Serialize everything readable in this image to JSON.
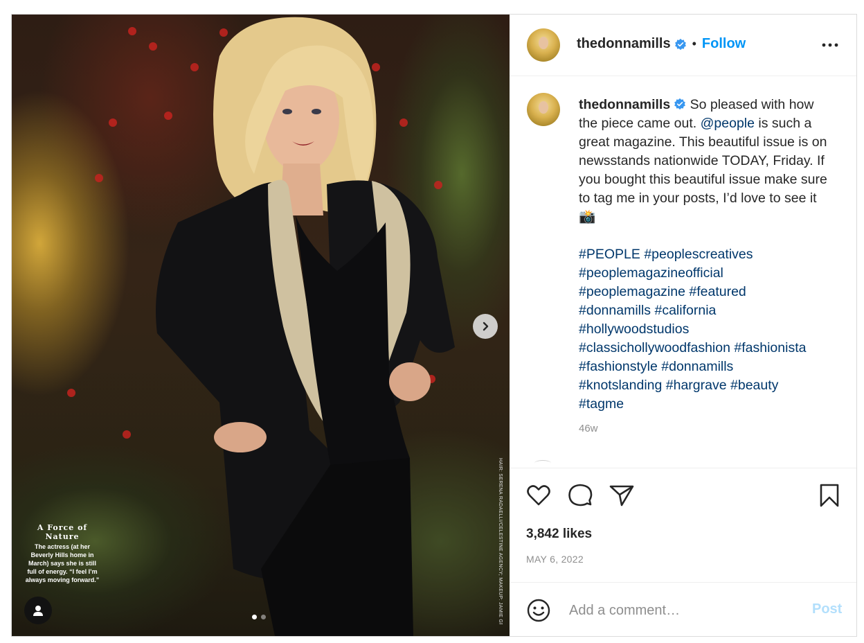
{
  "post": {
    "media": {
      "overlay_heading": "A Force of Nature",
      "overlay_body": "The actress (at her Beverly Hills home in March) says she is still full of energy. “I feel I’m always moving forward.”",
      "credit_text": "HAIR: SERENA RADAELLI/CELESTINE AGENCY; MAKEUP: JAMIE GREENBERG; STYLING: WARDROBE BY ANNIE",
      "slide_count": 2,
      "current_slide": 1
    },
    "header": {
      "username": "thedonnamills",
      "verified": true,
      "separator": "•",
      "follow_label": "Follow",
      "more_icon": "more-horizontal-icon"
    },
    "caption": {
      "username": "thedonnamills",
      "text_part1": " So pleased with how the piece came out. ",
      "mention": "@people",
      "text_part2": " is such a great magazine. This beautiful issue is on newsstands nationwide TODAY, Friday. If you bought this beautiful issue make sure to tag me in your posts, I’d love to see it 📸",
      "hashtags": [
        "#PEOPLE",
        "#peoplescreatives",
        "#peoplemagazineofficial",
        "#peoplemagazine",
        "#featured",
        "#donnamills",
        "#california",
        "#hollywoodstudios",
        "#classichollywoodfashion",
        "#fashionista",
        "#fashionstyle",
        "#donnamills",
        "#knotslanding",
        "#hargrave",
        "#beauty",
        "#tagme"
      ],
      "time_ago": "46w"
    },
    "actions": {
      "like_icon": "heart-icon",
      "comment_icon": "comment-icon",
      "share_icon": "send-icon",
      "save_icon": "bookmark-icon",
      "likes": "3,842 likes",
      "date": "MAY 6, 2022"
    },
    "comment_box": {
      "emoji_icon": "smiley-icon",
      "placeholder": "Add a comment…",
      "post_label": "Post"
    },
    "colors": {
      "link_blue": "#0095f6",
      "hashtag": "#00376b",
      "muted": "#8e8e8e",
      "post_disabled": "#b2dffc"
    }
  }
}
